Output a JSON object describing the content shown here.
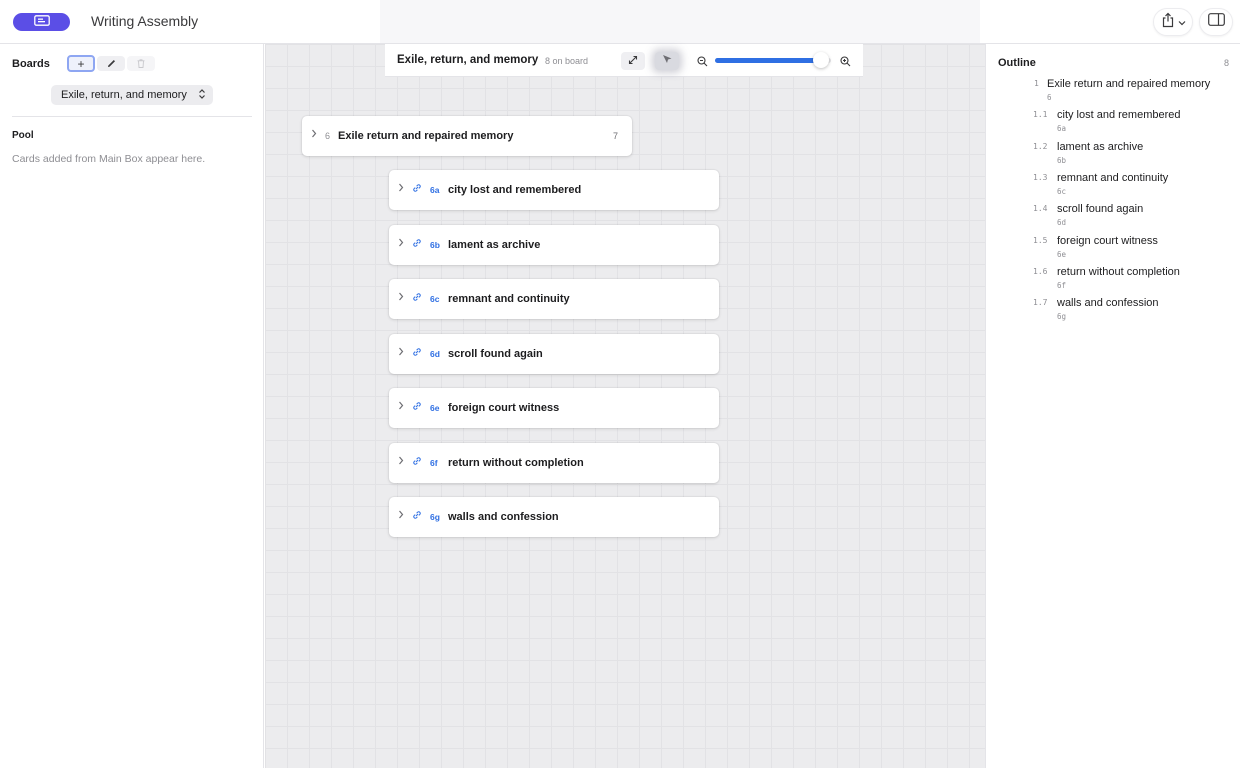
{
  "app": {
    "title": "Writing Assembly"
  },
  "sidebar": {
    "boards_label": "Boards",
    "add_label": "+",
    "selected_board": "Exile, return, and memory",
    "pool_label": "Pool",
    "pool_empty": "Cards added from Main Box appear here."
  },
  "canvas": {
    "board_name": "Exile, return, and memory",
    "board_count": "8 on board",
    "zoom": 0.88,
    "parent_card": {
      "number": "6",
      "title": "Exile return and repaired memory",
      "count": "7"
    },
    "child_cards": [
      {
        "code": "6a",
        "title": "city lost and remembered"
      },
      {
        "code": "6b",
        "title": "lament as archive"
      },
      {
        "code": "6c",
        "title": "remnant and continuity"
      },
      {
        "code": "6d",
        "title": "scroll found again"
      },
      {
        "code": "6e",
        "title": "foreign court witness"
      },
      {
        "code": "6f",
        "title": "return without completion"
      },
      {
        "code": "6g",
        "title": "walls and confession"
      }
    ]
  },
  "outline": {
    "title": "Outline",
    "count": "8",
    "items": [
      {
        "num": "1",
        "title": "Exile return and repaired memory",
        "code": "6"
      },
      {
        "num": "1.1",
        "title": "city lost and remembered",
        "code": "6a"
      },
      {
        "num": "1.2",
        "title": "lament as archive",
        "code": "6b"
      },
      {
        "num": "1.3",
        "title": "remnant and continuity",
        "code": "6c"
      },
      {
        "num": "1.4",
        "title": "scroll found again",
        "code": "6d"
      },
      {
        "num": "1.5",
        "title": "foreign court witness",
        "code": "6e"
      },
      {
        "num": "1.6",
        "title": "return without completion",
        "code": "6f"
      },
      {
        "num": "1.7",
        "title": "walls and confession",
        "code": "6g"
      }
    ]
  },
  "colors": {
    "accent": "#5b4ee6",
    "link": "#2f6fe3",
    "canvas": "#ececee"
  },
  "icons": {
    "app": "board-icon",
    "share": "share-icon",
    "sidebar_toggle": "sidebar-toggle-icon",
    "edit": "pencil-icon",
    "delete": "trash-icon",
    "expand": "expand-icon",
    "select": "cursor-icon",
    "zoom_out": "zoom-out-icon",
    "zoom_in": "zoom-in-icon",
    "link": "link-icon",
    "chevron": "chevron-right-icon"
  }
}
